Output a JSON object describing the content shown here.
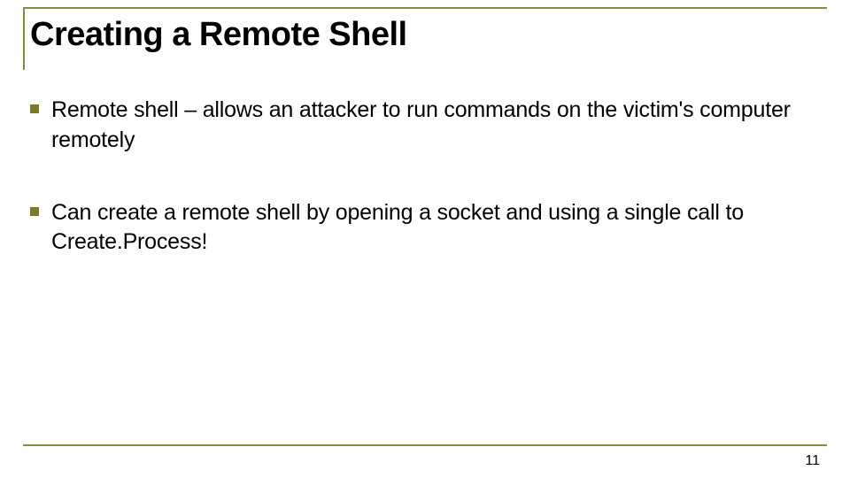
{
  "slide": {
    "title": "Creating a Remote Shell",
    "bullets": [
      "Remote shell – allows an attacker to run commands on the victim's computer remotely",
      "Can create a remote shell by opening a socket and using a single call to Create.Process!"
    ],
    "page_number": "11"
  }
}
